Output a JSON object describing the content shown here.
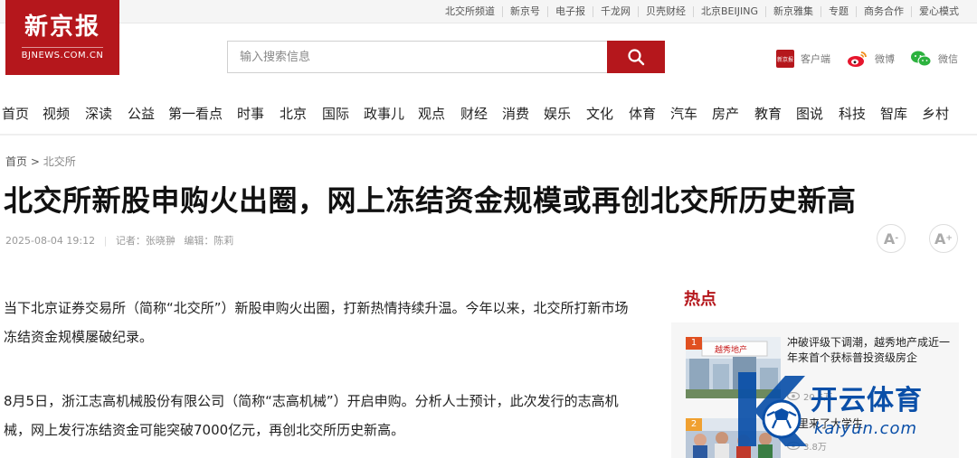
{
  "topnav": [
    "北交所频道",
    "新京号",
    "电子报",
    "千龙网",
    "贝壳财经",
    "北京BEIJING",
    "新京雅集",
    "专题",
    "商务合作",
    "爱心模式"
  ],
  "logo": {
    "main": "新京报",
    "sub": "BJNEWS.COM.CN"
  },
  "search": {
    "placeholder": "输入搜索信息"
  },
  "social": {
    "client": "客户端",
    "weibo": "微博",
    "wechat": "微信",
    "client_icon_text": "新京报"
  },
  "mainnav": [
    "首页",
    "视频",
    "深读",
    "公益",
    "第一看点",
    "时事",
    "北京",
    "国际",
    "政事儿",
    "观点",
    "财经",
    "消费",
    "娱乐",
    "文化",
    "体育",
    "汽车",
    "房产",
    "教育",
    "图说",
    "科技",
    "智库",
    "乡村"
  ],
  "breadcrumb": {
    "home": "首页",
    "sep": ">",
    "section": "北交所"
  },
  "article": {
    "title": "北交所新股申购火出圈，网上冻结资金规模或再创北交所历史新高",
    "date": "2025-08-04 19:12",
    "reporter": "记者：张晓翀",
    "editor": "编辑：陈莉",
    "paragraphs": [
      "当下北京证券交易所（简称“北交所”）新股申购火出圈，打新热情持续升温。今年以来，北交所打新市场冻结资金规模屡破纪录。",
      "8月5日，浙江志高机械股份有限公司（简称“志高机械”）开启申购。分析人士预计，此次发行的志高机械，网上发行冻结资金可能突破7000亿元，再创北交所历史新高。"
    ]
  },
  "font_buttons": {
    "increase": "A",
    "decrease": "A"
  },
  "hot": {
    "title": "热点",
    "items": [
      {
        "rank": "1",
        "title": "冲破评级下调潮，越秀地产成近一年来首个获标普投资级房企",
        "views": "20.5万",
        "thumb_label": "越秀地产"
      },
      {
        "rank": "2",
        "title": "离里来了大学生",
        "views": "3.8万"
      }
    ]
  },
  "watermark": {
    "name": "开云体育",
    "url": "kaiyun.com"
  },
  "colors": {
    "brand_red": "#b5171c",
    "watermark_blue": "#0a4fa8"
  }
}
